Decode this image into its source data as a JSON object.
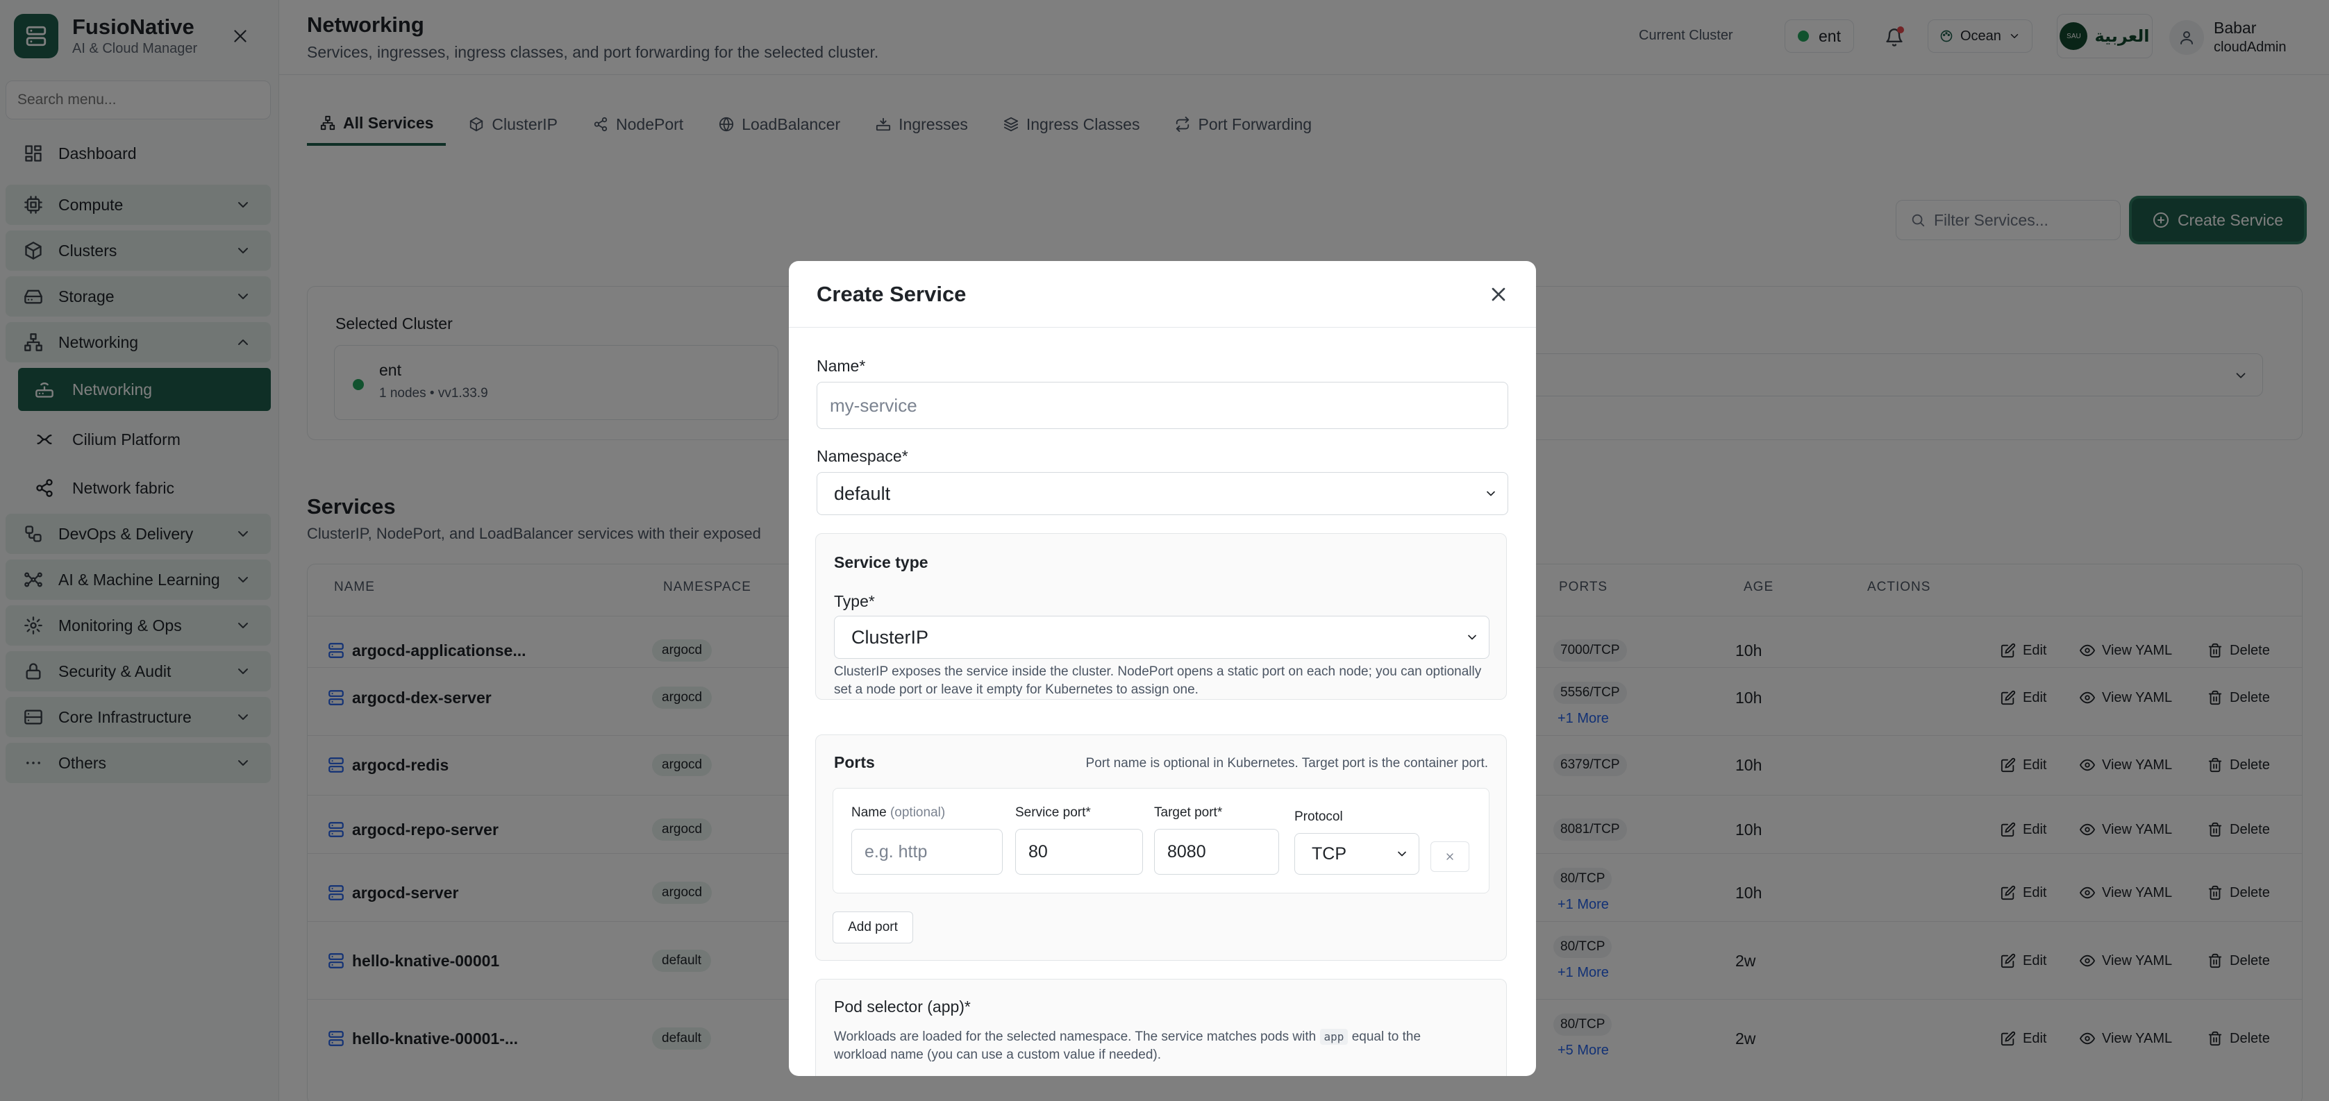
{
  "brand": {
    "name": "FusioNative",
    "subtitle": "AI & Cloud Manager"
  },
  "sidebar": {
    "search_placeholder": "Search menu...",
    "items": [
      {
        "label": "Dashboard",
        "icon": "dashboard-icon"
      },
      {
        "label": "Compute",
        "icon": "cpu-icon"
      },
      {
        "label": "Clusters",
        "icon": "cube-icon"
      },
      {
        "label": "Storage",
        "icon": "hard-drive-icon"
      },
      {
        "label": "Networking",
        "icon": "network-icon",
        "expanded": true
      },
      {
        "label": "DevOps & Delivery",
        "icon": "workflow-icon"
      },
      {
        "label": "AI & Machine Learning",
        "icon": "ai-network-icon"
      },
      {
        "label": "Monitoring & Ops",
        "icon": "monitor-icon"
      },
      {
        "label": "Security & Audit",
        "icon": "lock-icon"
      },
      {
        "label": "Core Infrastructure",
        "icon": "server-icon"
      },
      {
        "label": "Others",
        "icon": "ellipsis-icon"
      }
    ],
    "sub_items": [
      {
        "label": "Networking",
        "icon": "router-icon",
        "active": true
      },
      {
        "label": "Cilium Platform",
        "icon": "cilium-icon"
      },
      {
        "label": "Network fabric",
        "icon": "share-icon"
      }
    ]
  },
  "header": {
    "title": "Networking",
    "subtitle": "Services, ingresses, ingress classes, and port forwarding for the selected cluster.",
    "current_cluster_label": "Current Cluster",
    "current_cluster": "ent",
    "theme": "Ocean",
    "language": "العربية",
    "language_badge": "SAU",
    "user_name": "Babar",
    "user_role": "cloudAdmin"
  },
  "tabs": [
    {
      "label": "All Services",
      "active": true
    },
    {
      "label": "ClusterIP"
    },
    {
      "label": "NodePort"
    },
    {
      "label": "LoadBalancer"
    },
    {
      "label": "Ingresses"
    },
    {
      "label": "Ingress Classes"
    },
    {
      "label": "Port Forwarding"
    }
  ],
  "toolbar": {
    "filter_placeholder": "Filter Services...",
    "create_label": "Create Service"
  },
  "cluster_card": {
    "title": "Selected Cluster",
    "name": "ent",
    "meta": "1 nodes • vv1.33.9"
  },
  "services": {
    "title": "Services",
    "subtitle": "ClusterIP, NodePort, and LoadBalancer services with their exposed",
    "columns": [
      "NAME",
      "NAMESPACE",
      "PORTS",
      "AGE",
      "ACTIONS"
    ],
    "actions": {
      "edit": "Edit",
      "view": "View YAML",
      "delete": "Delete"
    },
    "rows": [
      {
        "name": "argocd-applicationse...",
        "namespace": "argocd",
        "port": "7000/TCP",
        "more": "",
        "age": "10h"
      },
      {
        "name": "argocd-dex-server",
        "namespace": "argocd",
        "port": "5556/TCP",
        "more": "+1 More",
        "age": "10h"
      },
      {
        "name": "argocd-redis",
        "namespace": "argocd",
        "port": "6379/TCP",
        "more": "",
        "age": "10h"
      },
      {
        "name": "argocd-repo-server",
        "namespace": "argocd",
        "port": "8081/TCP",
        "more": "",
        "age": "10h"
      },
      {
        "name": "argocd-server",
        "namespace": "argocd",
        "port": "80/TCP",
        "more": "+1 More",
        "age": "10h"
      },
      {
        "name": "hello-knative-00001",
        "namespace": "default",
        "port": "80/TCP",
        "more": "+1 More",
        "age": "2w"
      },
      {
        "name": "hello-knative-00001-...",
        "namespace": "default",
        "port": "80/TCP",
        "more": "+5 More",
        "age": "2w"
      }
    ]
  },
  "modal": {
    "title": "Create Service",
    "name_label": "Name*",
    "name_placeholder": "my-service",
    "namespace_label": "Namespace*",
    "namespace_value": "default",
    "service_type_title": "Service type",
    "type_label": "Type*",
    "type_value": "ClusterIP",
    "type_hint": "ClusterIP exposes the service inside the cluster. NodePort opens a static port on each node; you can optionally set a node port or leave it empty for Kubernetes to assign one.",
    "ports_title": "Ports",
    "ports_hint": "Port name is optional in Kubernetes. Target port is the container port.",
    "port_name_label": "Name",
    "port_name_optional": "(optional)",
    "port_name_placeholder": "e.g. http",
    "service_port_label": "Service port*",
    "service_port_value": "80",
    "target_port_label": "Target port*",
    "target_port_value": "8080",
    "protocol_label": "Protocol",
    "protocol_value": "TCP",
    "add_port_label": "Add port",
    "pod_selector_title": "Pod selector (app)*",
    "pod_selector_hint_1": "Workloads are loaded for the selected namespace. The service matches pods with",
    "pod_selector_code": "app",
    "pod_selector_hint_2": "equal to the",
    "pod_selector_hint_3": "workload name (you can use a custom value if needed)."
  },
  "colors": {
    "brand": "#1f5f4c",
    "link": "#2563eb",
    "status_ok": "#22a45d"
  }
}
